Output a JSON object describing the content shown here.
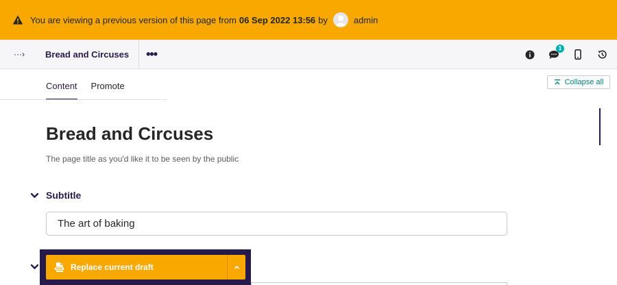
{
  "banner": {
    "prefix": "You are viewing a previous version of this page from",
    "date": "06 Sep 2022 13:56",
    "by": "by",
    "user": "admin"
  },
  "header": {
    "breadcrumb_toggle": "···›",
    "page_name": "Bread and Circuses",
    "more": "•••",
    "comments_count": "1"
  },
  "tabs": [
    {
      "label": "Content",
      "active": true
    },
    {
      "label": "Promote",
      "active": false
    }
  ],
  "collapse_all": "Collapse all",
  "content": {
    "title": "Bread and Circuses",
    "title_help": "The page title as you'd like it to be seen by the public",
    "subtitle_label": "Subtitle",
    "subtitle_value": "The art of baking"
  },
  "footer": {
    "action_label": "Replace current draft"
  },
  "colors": {
    "banner": "#f9a800",
    "brand": "#261a4b",
    "accent": "#00b0b1"
  }
}
